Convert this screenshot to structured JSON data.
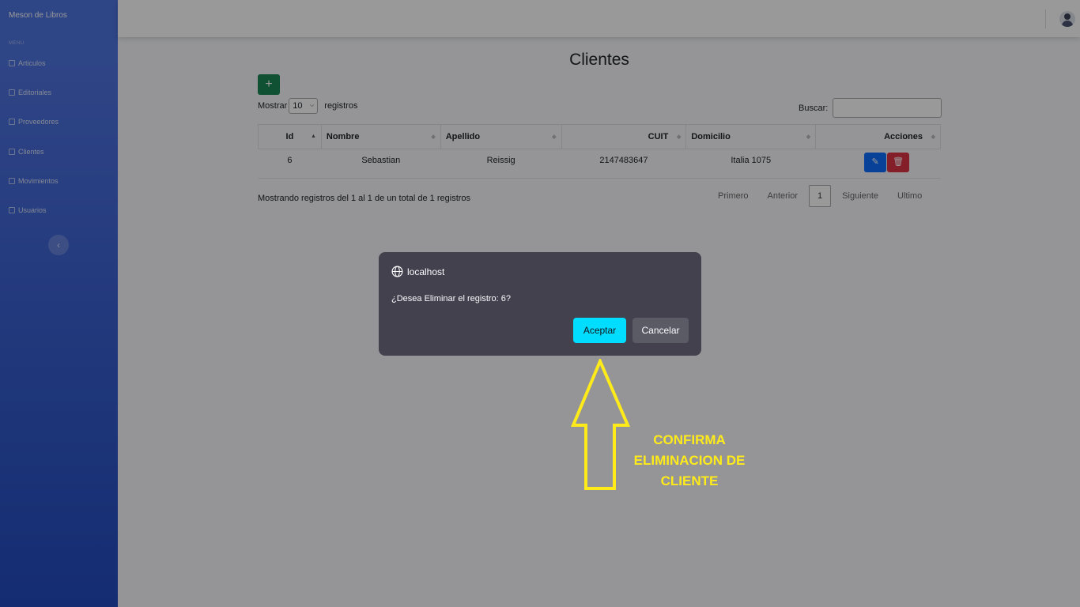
{
  "sidebar": {
    "brand": "Meson de Libros",
    "heading": "MENU",
    "items": [
      {
        "label": "Articulos"
      },
      {
        "label": "Editoriales"
      },
      {
        "label": "Proveedores"
      },
      {
        "label": "Clientes"
      },
      {
        "label": "Movimientos"
      },
      {
        "label": "Usuarios"
      }
    ],
    "toggle_icon": "‹"
  },
  "main": {
    "title": "Clientes",
    "add_label": "+",
    "show_prefix": "Mostrar",
    "page_length": "10",
    "show_suffix": "registros",
    "search_label": "Buscar:",
    "table": {
      "headers": [
        "Id",
        "Nombre",
        "Apellido",
        "CUIT",
        "Domicilio",
        "Acciones"
      ],
      "rows": [
        {
          "id": "6",
          "nombre": "Sebastian",
          "apellido": "Reissig",
          "cuit": "2147483647",
          "domicilio": "Italia 1075"
        }
      ]
    },
    "info": "Mostrando registros del 1 al 1 de un total de 1 registros",
    "pager": {
      "first": "Primero",
      "prev": "Anterior",
      "current": "1",
      "next": "Siguiente",
      "last": "Ultimo"
    }
  },
  "dialog": {
    "origin": "localhost",
    "message": "¿Desea Eliminar el registro: 6?",
    "ok": "Aceptar",
    "cancel": "Cancelar"
  },
  "annotation": {
    "line1": "CONFIRMA",
    "line2": "ELIMINACION DE",
    "line3": "CLIENTE",
    "color": "#ffeb1a"
  }
}
